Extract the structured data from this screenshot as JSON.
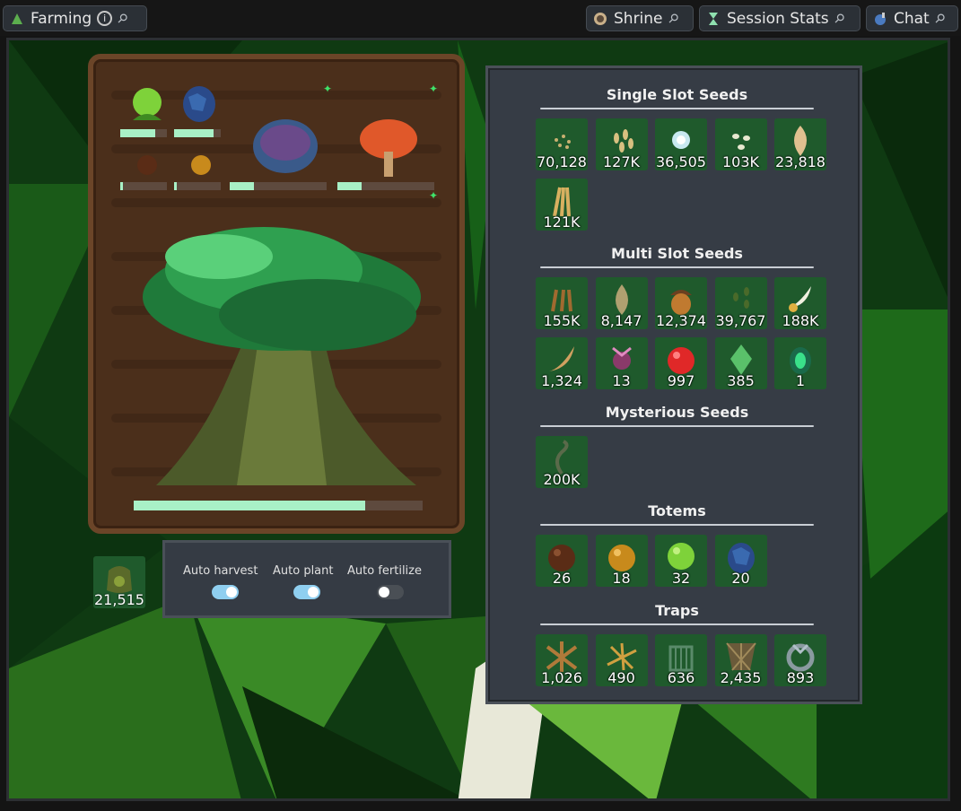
{
  "tabs": {
    "farming": "Farming",
    "shrine": "Shrine",
    "session_stats": "Session Stats",
    "chat": "Chat"
  },
  "sections": {
    "single": {
      "title": "Single Slot Seeds",
      "items": [
        {
          "icon": "tiny-seeds-icon",
          "count": "70,128"
        },
        {
          "icon": "grain-seeds-icon",
          "count": "127K"
        },
        {
          "icon": "glowing-seed-icon",
          "count": "36,505"
        },
        {
          "icon": "white-seeds-icon",
          "count": "103K"
        },
        {
          "icon": "large-seed-icon",
          "count": "23,818"
        },
        {
          "icon": "wheat-icon",
          "count": "121K"
        }
      ]
    },
    "multi": {
      "title": "Multi Slot Seeds",
      "items": [
        {
          "icon": "brown-seeds-icon",
          "count": "155K"
        },
        {
          "icon": "husk-seed-icon",
          "count": "8,147"
        },
        {
          "icon": "acorn-icon",
          "count": "12,374"
        },
        {
          "icon": "sprout-seeds-icon",
          "count": "39,767"
        },
        {
          "icon": "feather-seed-icon",
          "count": "188K"
        },
        {
          "icon": "leaf-pod-icon",
          "count": "1,324"
        },
        {
          "icon": "thistle-icon",
          "count": "13"
        },
        {
          "icon": "red-fruit-icon",
          "count": "997"
        },
        {
          "icon": "green-crystal-icon",
          "count": "385"
        },
        {
          "icon": "emerald-seed-icon",
          "count": "1"
        }
      ]
    },
    "mysterious": {
      "title": "Mysterious Seeds",
      "items": [
        {
          "icon": "vine-seed-icon",
          "count": "200K"
        }
      ]
    },
    "totems": {
      "title": "Totems",
      "items": [
        {
          "icon": "brown-totem-icon",
          "count": "26"
        },
        {
          "icon": "gold-totem-icon",
          "count": "18"
        },
        {
          "icon": "green-totem-icon",
          "count": "32"
        },
        {
          "icon": "blue-totem-icon",
          "count": "20"
        }
      ]
    },
    "traps": {
      "title": "Traps",
      "items": [
        {
          "icon": "wood-trap-icon",
          "count": "1,026"
        },
        {
          "icon": "branch-trap-icon",
          "count": "490"
        },
        {
          "icon": "cage-trap-icon",
          "count": "636"
        },
        {
          "icon": "net-trap-icon",
          "count": "2,435"
        },
        {
          "icon": "metal-trap-icon",
          "count": "893"
        }
      ]
    }
  },
  "auto": {
    "harvest_label": "Auto harvest",
    "harvest_on": true,
    "plant_label": "Auto plant",
    "plant_on": true,
    "fertilize_label": "Auto fertilize",
    "fertilize_on": false
  },
  "fertilizer": {
    "icon": "fertilizer-pouch-icon",
    "count": "21,515"
  },
  "plot": {
    "small_progress": [
      0.75,
      0.85,
      0.05,
      0.05
    ],
    "tree_progress": [
      0.25,
      0.25
    ],
    "big_tree_progress": 0.8
  },
  "colors": {
    "slot_green": "#1f5a2c",
    "progress_fill": "#a8f0c6",
    "toggle_on": "#8fcff0"
  }
}
